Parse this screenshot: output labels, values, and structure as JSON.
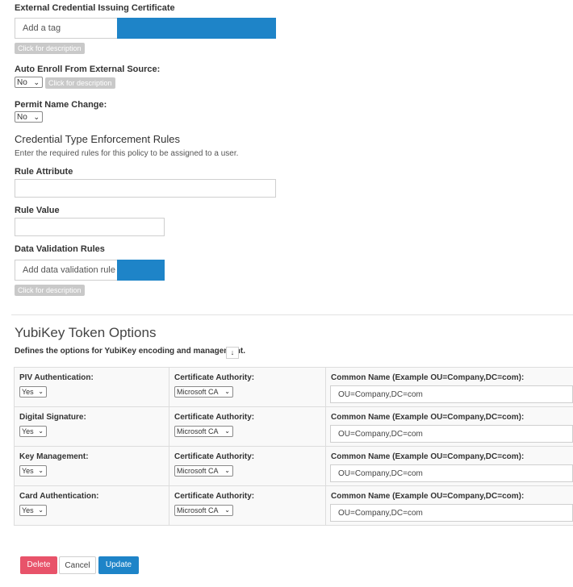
{
  "form": {
    "ext_cert": {
      "label": "External Credential Issuing Certificate",
      "placeholder": "Add a tag",
      "desc_button": "Click for description"
    },
    "auto_enroll": {
      "label": "Auto Enroll From External Source:",
      "value": "No",
      "desc_button": "Click for description"
    },
    "permit_name": {
      "label": "Permit Name Change:",
      "value": "No"
    },
    "enforcement": {
      "heading": "Credential Type Enforcement Rules",
      "help": "Enter the required rules for this policy to be assigned to a user.",
      "rule_attribute_label": "Rule Attribute",
      "rule_attribute_value": "",
      "rule_value_label": "Rule Value",
      "rule_value_value": ""
    },
    "data_validation": {
      "label": "Data Validation Rules",
      "placeholder": "Add data validation rule c",
      "desc_button": "Click for description"
    }
  },
  "yubikey": {
    "title": "YubiKey Token Options",
    "description": "Defines the options for YubiKey encoding and management.",
    "toggle_icon": "arrow-down-icon",
    "ca_label": "Certificate Authority:",
    "cn_label": "Common Name (Example OU=Company,DC=com):",
    "rows": [
      {
        "name": "PIV Authentication:",
        "value": "Yes",
        "ca": "Microsoft CA",
        "cn": "OU=Company,DC=com"
      },
      {
        "name": "Digital Signature:",
        "value": "Yes",
        "ca": "Microsoft CA",
        "cn": "OU=Company,DC=com"
      },
      {
        "name": "Key Management:",
        "value": "Yes",
        "ca": "Microsoft CA",
        "cn": "OU=Company,DC=com"
      },
      {
        "name": "Card Authentication:",
        "value": "Yes",
        "ca": "Microsoft CA",
        "cn": "OU=Company,DC=com"
      }
    ]
  },
  "actions": {
    "delete": "Delete",
    "cancel": "Cancel",
    "update": "Update"
  },
  "colors": {
    "accent": "#1e84c8",
    "danger": "#e8536a",
    "muted_button": "#c9c9c9"
  }
}
